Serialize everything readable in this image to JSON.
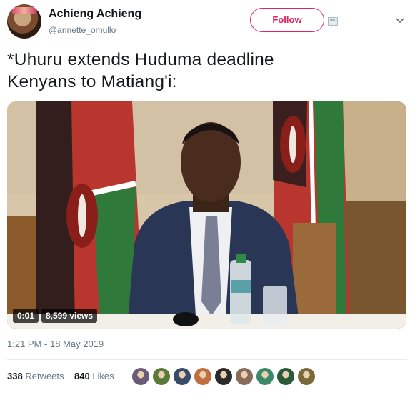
{
  "author": {
    "display_name": "Achieng Achieng",
    "handle": "@annette_omullo",
    "avatar_icon": "profile-photo"
  },
  "follow_label": "Follow",
  "tweet": {
    "text": "*Uhuru extends Huduma deadline\nKenyans to Matiang'i:"
  },
  "video": {
    "duration": "0:01",
    "views": "8,599 views"
  },
  "timestamp": "1:21 PM - 18 May 2019",
  "stats": {
    "retweets_count": "338",
    "retweets_label": "Retweets",
    "likes_count": "840",
    "likes_label": "Likes"
  },
  "likers": [
    {
      "name": "liker-avatar-1",
      "color": "#6b5a7a"
    },
    {
      "name": "liker-avatar-2",
      "color": "#5b7a3a"
    },
    {
      "name": "liker-avatar-3",
      "color": "#3a4a6a"
    },
    {
      "name": "liker-avatar-4",
      "color": "#c07040"
    },
    {
      "name": "liker-avatar-5",
      "color": "#2a2a2a"
    },
    {
      "name": "liker-avatar-6",
      "color": "#8a6a5a"
    },
    {
      "name": "liker-avatar-7",
      "color": "#3a8a6a"
    },
    {
      "name": "liker-avatar-8",
      "color": "#2a5a3a"
    },
    {
      "name": "liker-avatar-9",
      "color": "#7a6a3a"
    }
  ]
}
